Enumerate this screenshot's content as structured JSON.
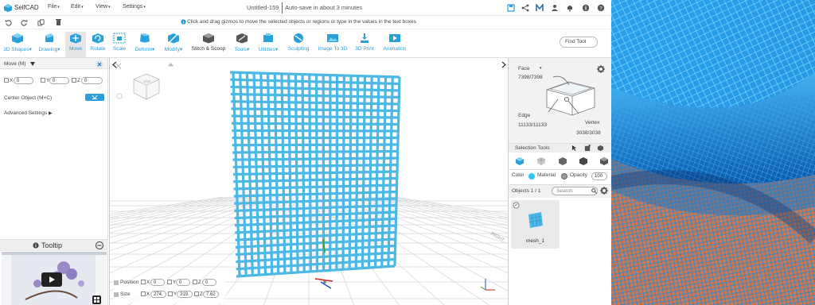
{
  "app": {
    "name": "SelfCAD",
    "menus": [
      "File",
      "Edit",
      "View",
      "Settings"
    ],
    "doc_title": "Untitled-159",
    "autosave": "Auto-save in about 3 minutes",
    "hint": "Click and drag gizmos to move the selected objects or regions or type in the values in the text boxes"
  },
  "toolbar": {
    "tools": [
      {
        "label": "3D Shapes",
        "dropdown": true
      },
      {
        "label": "Drawing",
        "dropdown": true
      },
      {
        "label": "Move",
        "dropdown": false
      },
      {
        "label": "Rotate",
        "dropdown": false
      },
      {
        "label": "Scale",
        "dropdown": false
      },
      {
        "label": "Deform",
        "dropdown": true
      },
      {
        "label": "Modify",
        "dropdown": true
      },
      {
        "label": "Stitch & Scoop",
        "dropdown": false
      },
      {
        "label": "Tools",
        "dropdown": true
      },
      {
        "label": "Utilities",
        "dropdown": true
      },
      {
        "label": "Sculpting",
        "dropdown": false
      },
      {
        "label": "Image To 3D",
        "dropdown": false
      },
      {
        "label": "3D Print",
        "dropdown": false
      },
      {
        "label": "Animation",
        "dropdown": false
      }
    ],
    "find_tool": "Find Tool"
  },
  "left_panel": {
    "title": "Move (M)",
    "x_label": "X",
    "x_value": "0",
    "y_label": "Y",
    "y_value": "0",
    "z_label": "Z",
    "z_value": "0",
    "center_object": "Center Object (M+C)",
    "advanced": "Advanced Settings"
  },
  "tooltip": {
    "label": "Tooltip"
  },
  "bottom_fields": {
    "position_label": "Position",
    "size_label": "Size",
    "pos_x": "0",
    "pos_y": "0",
    "pos_z": "0",
    "size_x": "274.",
    "size_y": "319.",
    "size_z": "7.62"
  },
  "right_panel": {
    "face_label": "Face",
    "face_count": "7398/7398",
    "edge_label": "Edge",
    "edge_count": "11133/11133",
    "vertex_label": "Vertex",
    "vertex_count": "3038/3038",
    "selection_tools": "Selection Tools",
    "color_label": "Color",
    "material_label": "Material",
    "opacity_label": "Opacity",
    "opacity_value": "100",
    "objects_label": "Objects 1 / 1",
    "search_placeholder": "Search",
    "mesh_name": "mesh_1"
  },
  "colors": {
    "accent": "#2a9fd8",
    "mesh": "#4bb8e6",
    "grid": "#d6d6d6"
  }
}
